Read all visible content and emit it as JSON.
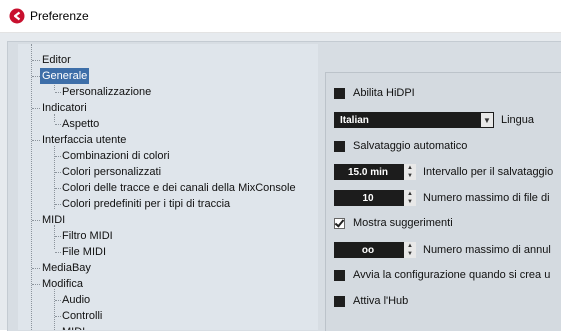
{
  "window": {
    "title": "Preferenze"
  },
  "tree": [
    {
      "label": "Editor",
      "level": 0
    },
    {
      "label": "Generale",
      "level": 0,
      "selected": true
    },
    {
      "label": "Personalizzazione",
      "level": 1
    },
    {
      "label": "Indicatori",
      "level": 0
    },
    {
      "label": "Aspetto",
      "level": 1
    },
    {
      "label": "Interfaccia utente",
      "level": 0
    },
    {
      "label": "Combinazioni di colori",
      "level": 1
    },
    {
      "label": "Colori personalizzati",
      "level": 1
    },
    {
      "label": "Colori delle tracce e dei canali della MixConsole",
      "level": 1
    },
    {
      "label": "Colori predefiniti per i tipi di traccia",
      "level": 1
    },
    {
      "label": "MIDI",
      "level": 0
    },
    {
      "label": "Filtro MIDI",
      "level": 1
    },
    {
      "label": "File MIDI",
      "level": 1
    },
    {
      "label": "MediaBay",
      "level": 0
    },
    {
      "label": "Modifica",
      "level": 0
    },
    {
      "label": "Audio",
      "level": 1
    },
    {
      "label": "Controlli",
      "level": 1
    },
    {
      "label": "MIDI",
      "level": 1
    }
  ],
  "settings": {
    "hidpi": {
      "label": "Abilita HiDPI",
      "checked": false
    },
    "language": {
      "value": "Italian",
      "label": "Lingua"
    },
    "autosave": {
      "label": "Salvataggio automatico",
      "checked": false
    },
    "autosave_interval": {
      "value": "15.0 min",
      "label": "Intervallo per il salvataggio"
    },
    "max_backup": {
      "value": "10",
      "label": "Numero massimo di file di"
    },
    "show_tips": {
      "label": "Mostra suggerimenti",
      "checked": true
    },
    "max_undo": {
      "value": "oo",
      "label": "Numero massimo di annul"
    },
    "run_setup": {
      "label": "Avvia la configurazione quando si crea u",
      "checked": false
    },
    "hub": {
      "label": "Attiva l'Hub",
      "checked": false
    }
  }
}
